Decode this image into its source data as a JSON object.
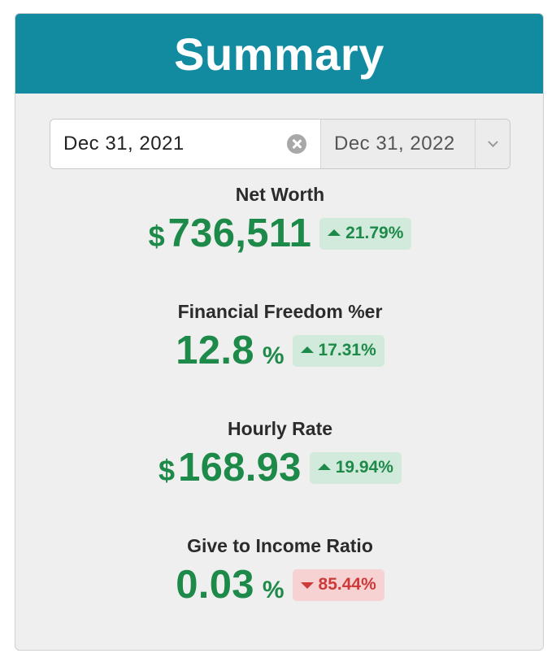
{
  "header": {
    "title": "Summary"
  },
  "date_range": {
    "start_value": "Dec 31, 2021",
    "end_value": "Dec 31, 2022",
    "clear_icon": "clear-icon",
    "toggle_icon": "chevron-down-icon"
  },
  "metrics": [
    {
      "label": "Net Worth",
      "prefix": "$",
      "value": "736,511",
      "suffix": "",
      "change": "21.79%",
      "direction": "up"
    },
    {
      "label": "Financial Freedom %er",
      "prefix": "",
      "value": "12.8",
      "suffix": "%",
      "change": "17.31%",
      "direction": "up"
    },
    {
      "label": "Hourly Rate",
      "prefix": "$",
      "value": "168.93",
      "suffix": "",
      "change": "19.94%",
      "direction": "up"
    },
    {
      "label": "Give to Income Ratio",
      "prefix": "",
      "value": "0.03",
      "suffix": "%",
      "change": "85.44%",
      "direction": "down"
    }
  ],
  "colors": {
    "header_bg": "#128ba1",
    "positive": "#1d8a4a",
    "positive_bg": "#d2eadb",
    "negative": "#cc3a3a",
    "negative_bg": "#f7d2d2"
  }
}
